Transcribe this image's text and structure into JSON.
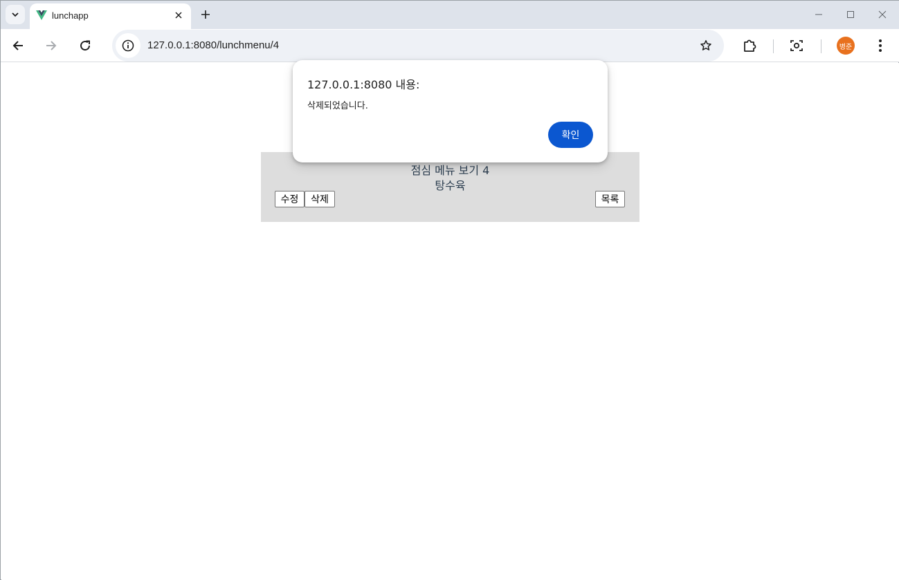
{
  "browser": {
    "tab_title": "lunchapp",
    "url": "127.0.0.1:8080/lunchmenu/4",
    "profile_initials": "병준",
    "profile_color": "#e8711e"
  },
  "page": {
    "title": "점심 메뉴 보기 4",
    "menu_name": "탕수육",
    "buttons": {
      "edit": "수정",
      "delete": "삭제",
      "list": "목록"
    },
    "panel_color": "#dddddd"
  },
  "dialog": {
    "title": "127.0.0.1:8080 내용:",
    "message": "삭제되었습니다.",
    "ok_label": "확인",
    "ok_color": "#0b57d0"
  }
}
